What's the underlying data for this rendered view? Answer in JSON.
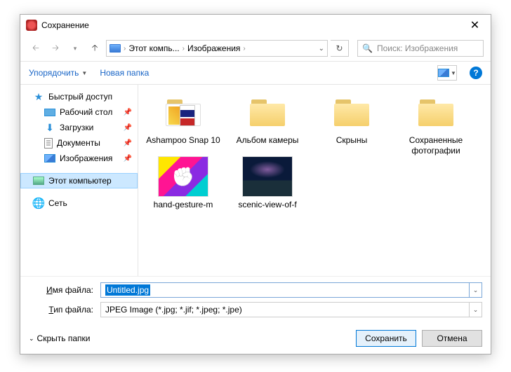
{
  "dialog": {
    "title": "Сохранение"
  },
  "breadcrumb": {
    "root": "Этот компь...",
    "folder": "Изображения"
  },
  "search": {
    "placeholder": "Поиск: Изображения"
  },
  "toolbar": {
    "organize": "Упорядочить",
    "newfolder": "Новая папка"
  },
  "tree": {
    "quick": "Быстрый доступ",
    "desktop": "Рабочий стол",
    "downloads": "Загрузки",
    "documents": "Документы",
    "pictures": "Изображения",
    "thispc": "Этот компьютер",
    "network": "Сеть"
  },
  "items": {
    "ashampoo": "Ashampoo Snap 10",
    "camera": "Альбом камеры",
    "screens": "Скрыны",
    "saved": "Сохраненные фотографии",
    "hand": "hand-gesture-m",
    "scenic": "scenic-view-of-f"
  },
  "form": {
    "name_label": "Имя файла:",
    "name_value": "Untitled.jpg",
    "type_label": "Тип файла:",
    "type_value": "JPEG Image (*.jpg; *.jif; *.jpeg; *.jpe)"
  },
  "actions": {
    "hide": "Скрыть папки",
    "save": "Сохранить",
    "cancel": "Отмена"
  }
}
